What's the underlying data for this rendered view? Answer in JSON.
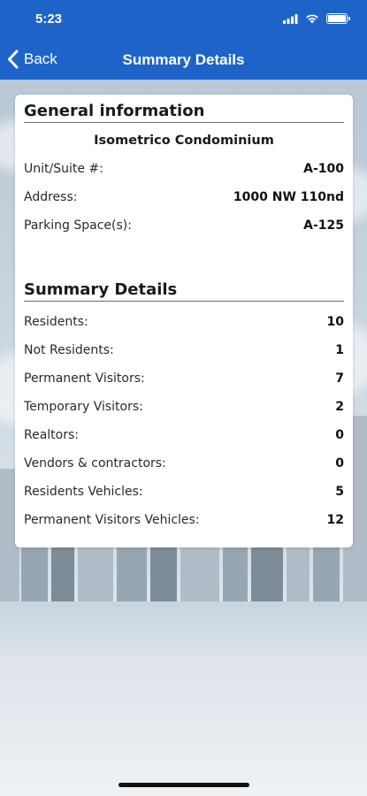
{
  "status": {
    "time": "5:23"
  },
  "nav": {
    "back_label": "Back",
    "title": "Summary Details"
  },
  "general": {
    "title": "General information",
    "condo_name": "Isometrico Condominium",
    "rows": [
      {
        "label": "Unit/Suite #:",
        "value": "A-100"
      },
      {
        "label": "Address:",
        "value": "1000 NW 110nd"
      },
      {
        "label": "Parking Space(s):",
        "value": "A-125"
      }
    ]
  },
  "summary": {
    "title": "Summary Details",
    "rows": [
      {
        "label": "Residents:",
        "value": "10"
      },
      {
        "label": "Not Residents:",
        "value": "1"
      },
      {
        "label": "Permanent Visitors:",
        "value": "7"
      },
      {
        "label": "Temporary Visitors:",
        "value": "2"
      },
      {
        "label": "Realtors:",
        "value": "0"
      },
      {
        "label": "Vendors & contractors:",
        "value": "0"
      },
      {
        "label": "Residents Vehicles:",
        "value": "5"
      },
      {
        "label": "Permanent Visitors Vehicles:",
        "value": "12"
      }
    ]
  },
  "colors": {
    "header": "#1e64c8",
    "card": "#ffffff",
    "text": "#1a1a1a"
  },
  "icons": {
    "back": "chevron-left-icon",
    "signal": "cellular-signal-icon",
    "wifi": "wifi-icon",
    "battery": "battery-icon"
  }
}
